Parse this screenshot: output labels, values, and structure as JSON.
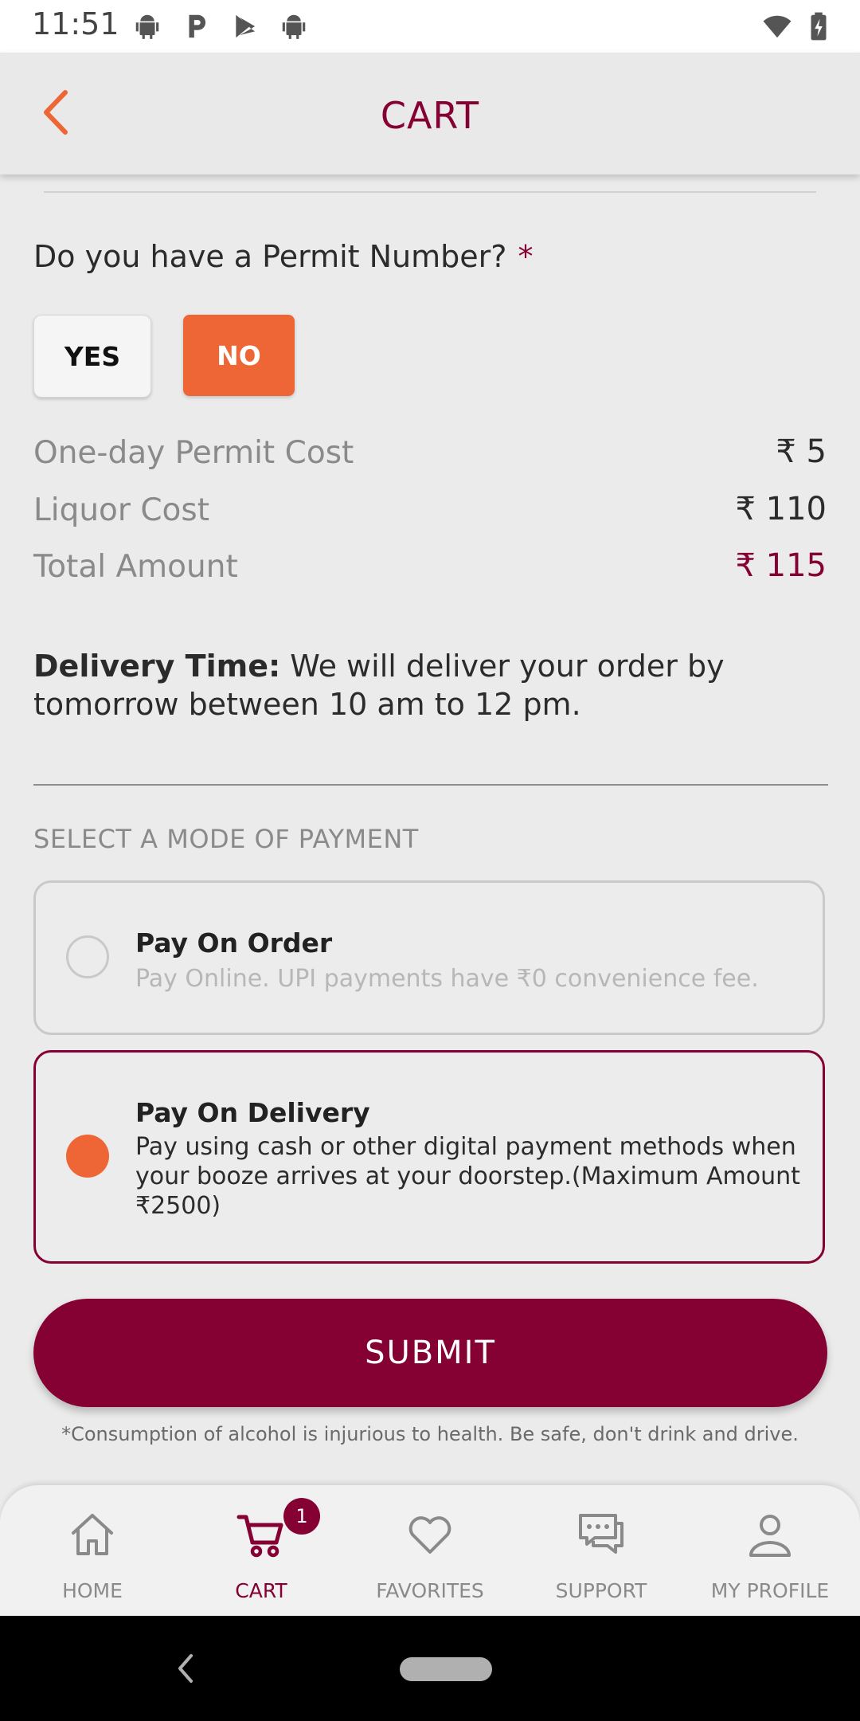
{
  "status_bar": {
    "time": "11:51",
    "left_icons": [
      "android-icon",
      "p-app-icon",
      "play-store-icon",
      "android-icon"
    ],
    "right_icons": [
      "wifi-icon",
      "battery-icon"
    ]
  },
  "app_bar": {
    "title": "CART",
    "back_icon": "chevron-left-icon"
  },
  "permit": {
    "question": "Do you have a Permit Number?",
    "required_mark": "*",
    "yes_label": "YES",
    "no_label": "NO",
    "selected": "NO"
  },
  "costs": [
    {
      "label": "One-day Permit Cost",
      "value": "₹ 5"
    },
    {
      "label": "Liquor Cost",
      "value": "₹ 110"
    },
    {
      "label": "Total Amount",
      "value": "₹ 115"
    }
  ],
  "delivery": {
    "label": "Delivery Time:",
    "text": " We will deliver your order by tomorrow between 10 am to 12 pm."
  },
  "payment": {
    "heading": "SELECT A MODE OF PAYMENT",
    "options": [
      {
        "title": "Pay On Order",
        "desc": "Pay Online. UPI payments have ₹0 convenience fee.",
        "selected": false
      },
      {
        "title": "Pay On Delivery",
        "desc": "Pay using cash or other digital payment methods when your booze arrives at your doorstep.(Maximum Amount ₹2500)",
        "selected": true
      }
    ]
  },
  "submit_label": "SUBMIT",
  "disclaimer": "*Consumption of alcohol is injurious to health. Be safe, don't drink and drive.",
  "bottom_nav": {
    "items": [
      {
        "label": "HOME",
        "icon": "home-icon",
        "active": false
      },
      {
        "label": "CART",
        "icon": "cart-icon",
        "active": true,
        "badge": "1"
      },
      {
        "label": "FAVORITES",
        "icon": "heart-icon",
        "active": false
      },
      {
        "label": "SUPPORT",
        "icon": "chat-icon",
        "active": false
      },
      {
        "label": "MY PROFILE",
        "icon": "profile-icon",
        "active": false
      }
    ]
  },
  "colors": {
    "accent": "#850033",
    "orange": "#ee6635",
    "background": "#ebebeb"
  }
}
